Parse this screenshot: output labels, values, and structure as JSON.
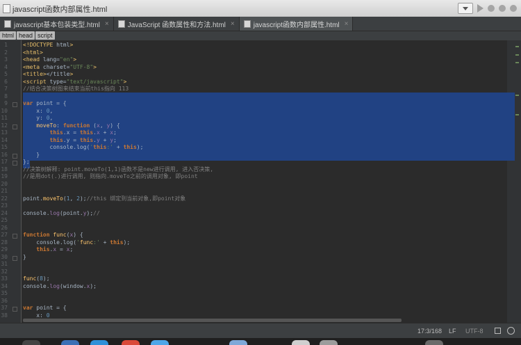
{
  "window": {
    "title": "javascript函数内部属性.html"
  },
  "tabs": [
    {
      "label": "javascript基本包装类型.html",
      "active": false
    },
    {
      "label": "JavaScript 函数属性和方法.html",
      "active": false
    },
    {
      "label": "javascript函数内部属性.html",
      "active": true
    }
  ],
  "breadcrumbs": [
    "html",
    "head",
    "script"
  ],
  "status": {
    "position": "17:3/168",
    "line_separator": "LF",
    "encoding": "UTF-8"
  },
  "icons": {
    "run": "play-icon",
    "debug": "bug-icon",
    "stop": "stop-icon",
    "lock": "lock-icon",
    "inspector": "face-icon"
  },
  "colors": {
    "selection": "#214283",
    "keyword": "#cc7832",
    "string": "#6a8759",
    "number": "#6897bb",
    "comment": "#808080"
  },
  "code_lines": [
    "<!DOCTYPE html>",
    "<html>",
    "<head lang=\"en\">",
    "<meta charset=\"UTF-8\">",
    "<title></title>",
    "<script type=\"text/javascript\">",
    "//结合决策树图来结束当前this指向 113",
    "",
    "var point = {",
    "    x: 0,",
    "    y: 0,",
    "    moveTo: function (x, y) {",
    "        this.x = this.x + x;",
    "        this.y = this.y + y;",
    "        console.log('this:' + this);",
    "    }",
    "};",
    "//决策树解释: point.moveTo(1,1)函数不是new进行调用, 进入否决策,",
    "//是用dot(.)进行调用, 则指向.moveTo之前的调用对象, 即point",
    "",
    "",
    "point.moveTo(1, 2);//this 绑定到当前对象,即point对象",
    "",
    "console.log(point.y);//",
    "",
    "",
    "function func(x) {",
    "    console.log('func:' + this);",
    "    this.x = x;",
    "}",
    "",
    "",
    "func(8);",
    "console.log(window.x);",
    "",
    "",
    "var point = {",
    "    x: 0"
  ]
}
